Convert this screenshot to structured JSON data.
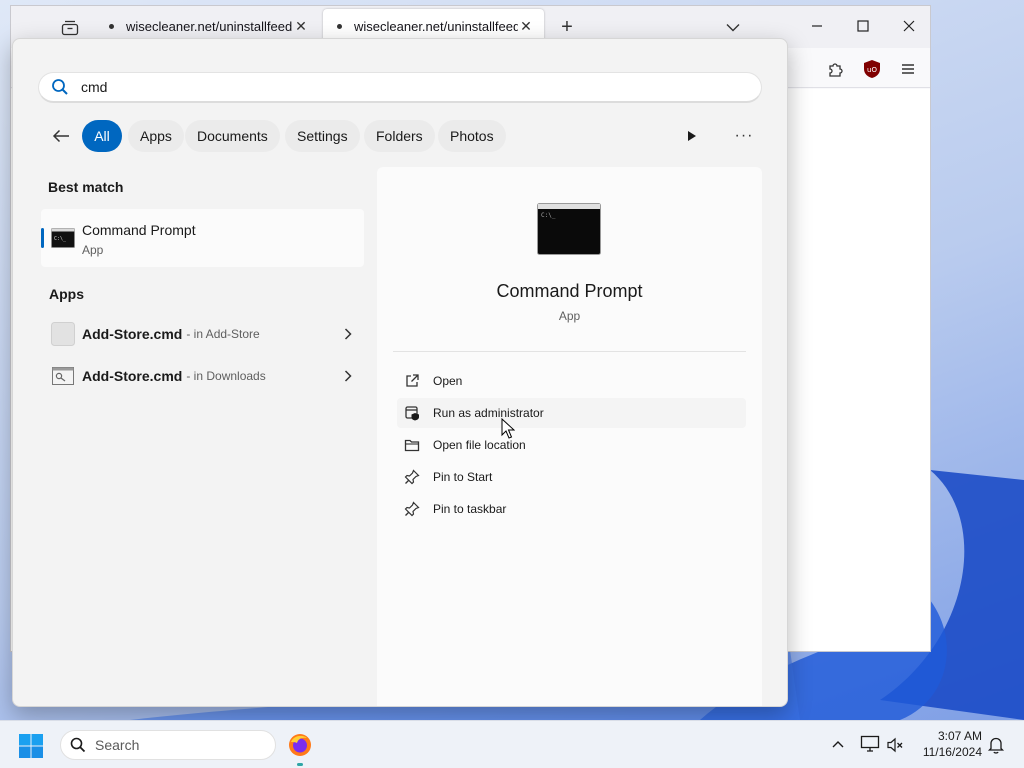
{
  "browser": {
    "tabs": [
      {
        "title": "wisecleaner.net/uninstallfeedback",
        "active": false
      },
      {
        "title": "wisecleaner.net/uninstallfeedback",
        "active": true
      }
    ],
    "tab_close_glyph": "✕",
    "new_tab_glyph": "+"
  },
  "search": {
    "query": "cmd",
    "filters": [
      {
        "label": "All",
        "active": true
      },
      {
        "label": "Apps",
        "active": false
      },
      {
        "label": "Documents",
        "active": false
      },
      {
        "label": "Settings",
        "active": false
      },
      {
        "label": "Folders",
        "active": false
      },
      {
        "label": "Photos",
        "active": false
      }
    ],
    "more_glyph": "···"
  },
  "results": {
    "best_match_heading": "Best match",
    "best_match": {
      "name": "Command Prompt",
      "kind": "App"
    },
    "apps_heading": "Apps",
    "apps": [
      {
        "name": "Add-Store.cmd",
        "location": "- in Add-Store"
      },
      {
        "name": "Add-Store.cmd",
        "location": "- in Downloads"
      }
    ]
  },
  "detail": {
    "name": "Command Prompt",
    "kind": "App",
    "actions": [
      {
        "label": "Open",
        "icon": "open-external-icon"
      },
      {
        "label": "Run as administrator",
        "icon": "shield-icon"
      },
      {
        "label": "Open file location",
        "icon": "folder-icon"
      },
      {
        "label": "Pin to Start",
        "icon": "pin-icon"
      },
      {
        "label": "Pin to taskbar",
        "icon": "pin-icon"
      }
    ]
  },
  "taskbar": {
    "search_label": "Search",
    "time": "3:07 AM",
    "date": "11/16/2024"
  },
  "colors": {
    "accent": "#0067c0",
    "panel_bg": "#f3f3f3",
    "taskbar_bg": "#eef2f8"
  }
}
